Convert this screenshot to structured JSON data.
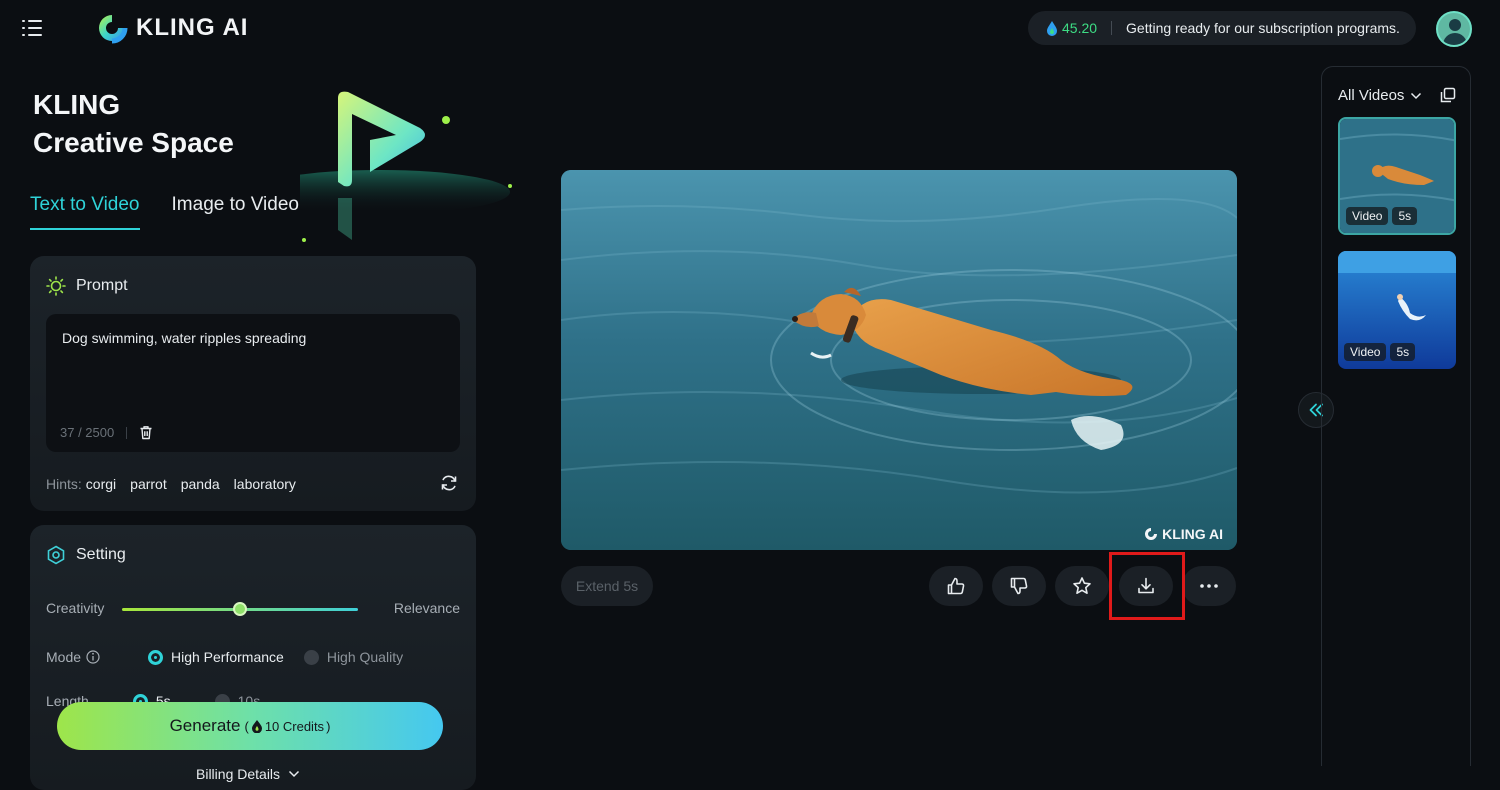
{
  "header": {
    "brand": "KLING AI",
    "credits": "45.20",
    "announcement": "Getting ready for our subscription programs."
  },
  "hero": {
    "title_line1": "KLING",
    "title_line2": "Creative Space"
  },
  "tabs": [
    {
      "label": "Text to Video",
      "active": true
    },
    {
      "label": "Image to Video",
      "active": false
    }
  ],
  "prompt": {
    "heading": "Prompt",
    "text": "Dog swimming, water ripples spreading",
    "counter": "37 / 2500",
    "hints_label": "Hints:",
    "hints": [
      "corgi",
      "parrot",
      "panda",
      "laboratory"
    ]
  },
  "setting": {
    "heading": "Setting",
    "creativity_label": "Creativity",
    "relevance_label": "Relevance",
    "slider_value": 0.5,
    "mode_label": "Mode",
    "mode_options": [
      "High Performance",
      "High Quality"
    ],
    "mode_selected": "High Performance",
    "length_label": "Length",
    "length_options": [
      "5s",
      "10s"
    ]
  },
  "generate": {
    "label": "Generate",
    "credits_text": "10 Credits",
    "paren_open": "(",
    "paren_close": ")"
  },
  "billing": {
    "label": "Billing Details"
  },
  "video": {
    "watermark": "KLING AI",
    "extend_label": "Extend 5s"
  },
  "actions": [
    "thumbs-up",
    "thumbs-down",
    "favorite",
    "download",
    "more"
  ],
  "highlight_color": "#e01a1a",
  "sidebar": {
    "title": "All Videos",
    "videos": [
      {
        "type": "Video",
        "duration": "5s"
      },
      {
        "type": "Video",
        "duration": "5s"
      }
    ]
  },
  "colors": {
    "accent": "#2fd3d8",
    "credit_green": "#3ddc84"
  }
}
